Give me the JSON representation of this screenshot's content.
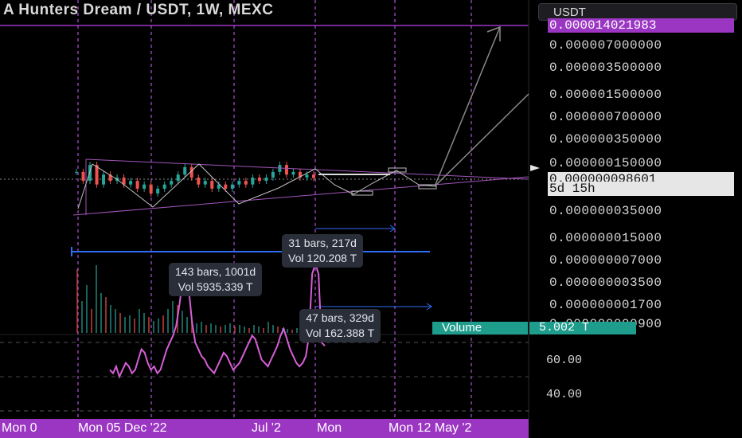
{
  "header": {
    "title": "A Hunters Dream / USDT, 1W, MEXC",
    "symbol_button": "USDT"
  },
  "price_axis": {
    "labels": [
      "0.000007000000",
      "0.000003500000",
      "0.000001500000",
      "0.000000700000",
      "0.000000350000",
      "0.000000150000",
      "0.000000035000",
      "0.000000015000",
      "0.000000007000",
      "0.000000003500",
      "0.000000001700",
      "0.000000000900"
    ],
    "top_tag": "0.000014021983",
    "last_price": "0.000000098601",
    "countdown": "5d 15h",
    "top_tag_color": "#9b36c2"
  },
  "volume": {
    "label": "Volume",
    "value": "5.002 T",
    "color": "#1e9d8c"
  },
  "rsi": {
    "labels": [
      "60.00",
      "40.00"
    ],
    "line_color": "#d65fd6",
    "values": [
      52,
      51,
      53,
      50,
      52,
      54,
      53,
      51,
      52,
      55,
      58,
      57,
      54,
      52,
      53,
      51,
      52,
      55,
      58,
      60,
      62,
      65,
      71,
      78,
      82,
      75,
      66,
      60,
      58,
      56,
      55,
      53,
      52,
      51,
      53,
      55,
      57,
      56,
      54,
      52,
      53,
      54,
      56,
      58,
      60,
      62,
      61,
      58,
      55,
      54,
      53,
      55,
      57,
      59,
      62,
      64,
      61,
      58,
      56,
      54,
      53,
      54,
      56,
      62,
      80,
      83,
      80,
      60,
      59
    ]
  },
  "measurements": [
    {
      "line1": "31 bars, 217d",
      "line2": "Vol 120.208 T"
    },
    {
      "line1": "143 bars, 1001d",
      "line2": "Vol 5935.339 T"
    },
    {
      "line1": "47 bars, 329d",
      "line2": "Vol 162.388 T"
    }
  ],
  "time_axis": {
    "labels": [
      "Mon 0",
      "Mon 05 Dec '22",
      "Jul '2",
      "Mon",
      "Mon 12 May '2"
    ],
    "bar_color": "#9b36c2"
  },
  "chart_data": {
    "type": "line",
    "title": "A Hunters Dream / USDT, 1W, MEXC",
    "xlabel": "",
    "ylabel": "",
    "y_scale": "log",
    "ylim": [
      9e-10,
      1.4021983e-05
    ],
    "x_ticks": [
      "Mon 0",
      "Mon 05 Dec '22",
      "Jul '2",
      "Mon",
      "Mon 12 May '2"
    ],
    "y_ticks": [
      "0.000007000000",
      "0.000003500000",
      "0.000001500000",
      "0.000000700000",
      "0.000000350000",
      "0.000000150000",
      "0.000000035000",
      "0.000000015000",
      "0.000000007000",
      "0.000000003500",
      "0.000000001700",
      "0.000000000900"
    ],
    "series": [
      {
        "values": [
          1.2e-07,
          9e-08,
          1.5e-07,
          8e-08,
          1.1e-07,
          9e-08,
          1e-07,
          8e-08,
          9e-08,
          7e-08,
          8e-08,
          6e-08,
          7e-08,
          8e-08,
          9e-08,
          1.1e-07,
          1.4e-07,
          1e-07,
          8e-08,
          9e-08,
          7e-08,
          8e-08,
          7e-08,
          8e-08,
          9e-08,
          8e-08,
          1e-07,
          9e-08,
          1e-07,
          1.2e-07,
          1.5e-07,
          1.1e-07,
          1.2e-07,
          1e-07,
          1.1e-07,
          9.8601e-08
        ]
      }
    ],
    "current_price": 9.8601e-08,
    "last_price_line_color": "#e6e6e6",
    "grid": false
  }
}
